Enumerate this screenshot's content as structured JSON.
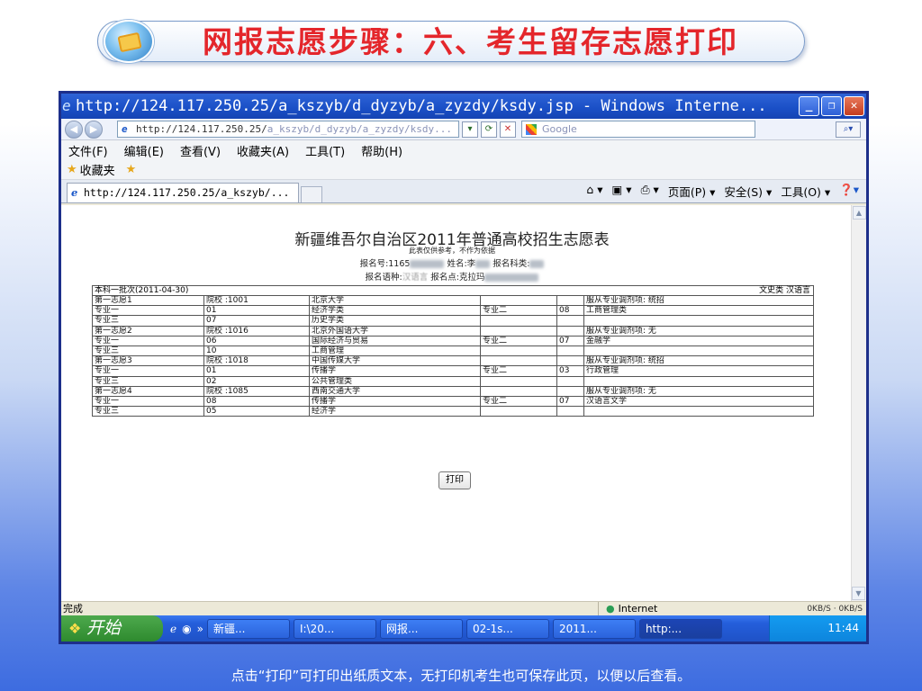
{
  "slide": {
    "title": "网报志愿步骤：六、考生留存志愿打印",
    "caption": "点击“打印”可打印出纸质文本，无打印机考生也可保存此页，以便以后查看。"
  },
  "window": {
    "title": "http://124.117.250.25/a_kszyb/d_dyzyb/a_zyzdy/ksdy.jsp - Windows Interne...",
    "address_main": "http://124.117.250.25/",
    "address_dim": "a_kszyb/d_dyzyb/a_zyzdy/ksdy...",
    "search_placeholder": "Google",
    "menu": [
      "文件(F)",
      "编辑(E)",
      "查看(V)",
      "收藏夹(A)",
      "工具(T)",
      "帮助(H)"
    ],
    "favorites_label": "收藏夹",
    "tab_label": "http://124.117.250.25/a_kszyb/...",
    "command_items": [
      "页面(P) ▾",
      "安全(S) ▾",
      "工具(O) ▾"
    ],
    "status_text": "完成",
    "zone_text": "Internet",
    "speed_text": "0KB/S · 0KB/S"
  },
  "taskbar": {
    "start_label": "开始",
    "tasks": [
      "新疆...",
      "I:\\20...",
      "网报...",
      "02-1s...",
      "2011...",
      "http:..."
    ],
    "clock": "11:44"
  },
  "document": {
    "title": "新疆维吾尔自治区2011年普通高校招生志愿表",
    "note": "此表仅供参考，不作为依据",
    "reg_no_label": "报名号:1165",
    "name_label": "姓名:李",
    "subject_label": "报名科类:",
    "lang_label": "报名语种:",
    "lang_value": "汉语言",
    "site_label": "报名点:克拉玛",
    "batch": "本科一批次(2011-04-30)",
    "batch_right": "文史类 汉语言",
    "rows": [
      [
        "第一志愿1",
        "院校 :1001",
        "北京大学",
        "",
        "",
        "服从专业调剂项: 统招"
      ],
      [
        "专业一",
        "01",
        "经济学类",
        "专业二",
        "08",
        "工商管理类"
      ],
      [
        "专业三",
        "07",
        "历史学类",
        "",
        "",
        ""
      ],
      [
        "第一志愿2",
        "院校 :1016",
        "北京外国语大学",
        "",
        "",
        "服从专业调剂项: 无"
      ],
      [
        "专业一",
        "06",
        "国际经济与贸易",
        "专业二",
        "07",
        "金融学"
      ],
      [
        "专业三",
        "10",
        "工商管理",
        "",
        "",
        ""
      ],
      [
        "第一志愿3",
        "院校 :1018",
        "中国传媒大学",
        "",
        "",
        "服从专业调剂项: 统招"
      ],
      [
        "专业一",
        "01",
        "传播学",
        "专业二",
        "03",
        "行政管理"
      ],
      [
        "专业三",
        "02",
        "公共管理类",
        "",
        "",
        ""
      ],
      [
        "第一志愿4",
        "院校 :1085",
        "西南交通大学",
        "",
        "",
        "服从专业调剂项: 无"
      ],
      [
        "专业一",
        "08",
        "传播学",
        "专业二",
        "07",
        "汉语言文学"
      ],
      [
        "专业三",
        "05",
        "经济学",
        "",
        "",
        ""
      ]
    ],
    "print_label": "打印"
  }
}
